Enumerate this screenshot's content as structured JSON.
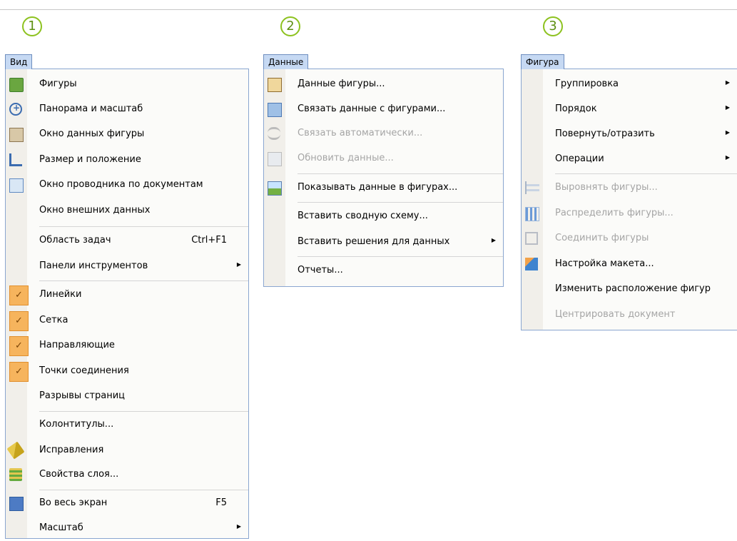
{
  "callouts": [
    "1",
    "2",
    "3"
  ],
  "menus": [
    {
      "title": "Вид",
      "items": [
        {
          "label": "Фигуры",
          "icon": "shapes-icon",
          "checked": false,
          "disabled": false
        },
        {
          "label": "Панорама и масштаб",
          "icon": "pan-zoom-icon",
          "checked": false,
          "disabled": false
        },
        {
          "label": "Окно данных фигуры",
          "icon": "shape-data-window-icon",
          "checked": false,
          "disabled": false
        },
        {
          "label": "Размер и положение",
          "icon": "size-position-icon",
          "checked": false,
          "disabled": false
        },
        {
          "label": "Окно проводника по документам",
          "icon": "drawing-explorer-icon",
          "checked": false,
          "disabled": false
        },
        {
          "label": "Окно внешних данных",
          "checked": false,
          "disabled": false
        },
        {
          "label": "Область задач",
          "shortcut": "Ctrl+F1",
          "checked": false,
          "disabled": false
        },
        {
          "label": "Панели инструментов",
          "submenu": true,
          "checked": false,
          "disabled": false
        },
        {
          "label": "Линейки",
          "checked": true,
          "disabled": false
        },
        {
          "label": "Сетка",
          "checked": true,
          "disabled": false
        },
        {
          "label": "Направляющие",
          "checked": true,
          "disabled": false
        },
        {
          "label": "Точки соединения",
          "checked": true,
          "disabled": false
        },
        {
          "label": "Разрывы страниц",
          "checked": false,
          "disabled": false
        },
        {
          "label": "Колонтитулы...",
          "checked": false,
          "disabled": false
        },
        {
          "label": "Исправления",
          "icon": "markup-icon",
          "checked": false,
          "disabled": false
        },
        {
          "label": "Свойства слоя...",
          "icon": "layers-icon",
          "checked": false,
          "disabled": false
        },
        {
          "label": "Во весь экран",
          "shortcut": "F5",
          "icon": "full-screen-icon",
          "checked": false,
          "disabled": false
        },
        {
          "label": "Масштаб",
          "submenu": true,
          "checked": false,
          "disabled": false
        }
      ]
    },
    {
      "title": "Данные",
      "items": [
        {
          "label": "Данные фигуры...",
          "icon": "shape-data-icon",
          "disabled": false
        },
        {
          "label": "Связать данные с фигурами...",
          "icon": "link-data-icon",
          "disabled": false
        },
        {
          "label": "Связать автоматически...",
          "icon": "automatic-link-icon",
          "disabled": true
        },
        {
          "label": "Обновить данные...",
          "icon": "refresh-data-icon",
          "disabled": true
        },
        {
          "label": "Показывать данные в фигурах...",
          "icon": "data-graphics-icon",
          "disabled": false
        },
        {
          "label": "Вставить сводную схему...",
          "disabled": false
        },
        {
          "label": "Вставить решения для данных",
          "submenu": true,
          "disabled": false
        },
        {
          "label": "Отчеты...",
          "disabled": false
        }
      ]
    },
    {
      "title": "Фигура",
      "items": [
        {
          "label": "Группировка",
          "submenu": true,
          "disabled": false
        },
        {
          "label": "Порядок",
          "submenu": true,
          "disabled": false
        },
        {
          "label": "Повернуть/отразить",
          "submenu": true,
          "disabled": false
        },
        {
          "label": "Операции",
          "submenu": true,
          "disabled": false
        },
        {
          "label": "Выровнять фигуры...",
          "icon": "align-shapes-icon",
          "disabled": true
        },
        {
          "label": "Распределить фигуры...",
          "icon": "distribute-shapes-icon",
          "disabled": true
        },
        {
          "label": "Соединить фигуры",
          "icon": "connect-shapes-icon",
          "disabled": true
        },
        {
          "label": "Настройка макета...",
          "icon": "layout-settings-icon",
          "disabled": false
        },
        {
          "label": "Изменить расположение фигур",
          "disabled": false
        },
        {
          "label": "Центрировать документ",
          "disabled": true
        }
      ]
    }
  ]
}
